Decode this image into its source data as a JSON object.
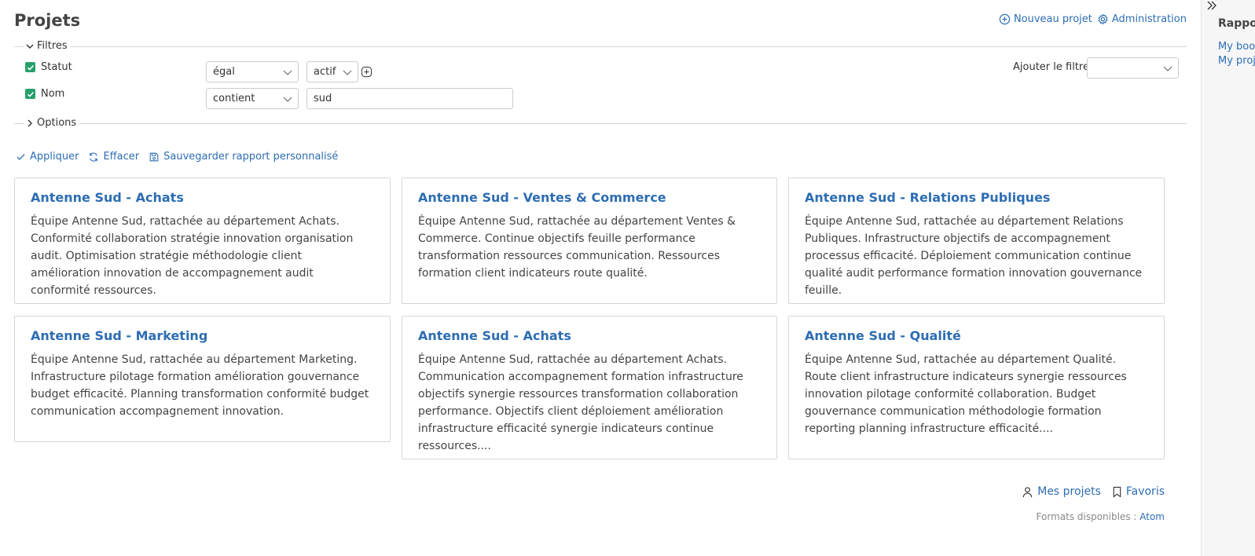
{
  "header": {
    "title": "Projets",
    "new_project": "Nouveau projet",
    "administration": "Administration"
  },
  "filters": {
    "legend": "Filtres",
    "rows": [
      {
        "label": "Statut",
        "operator": "égal",
        "value": "actif",
        "checked": true
      },
      {
        "label": "Nom",
        "operator": "contient",
        "value": "sud",
        "checked": true
      }
    ],
    "add_filter_label": "Ajouter le filtre",
    "add_filter_value": ""
  },
  "options": {
    "legend": "Options"
  },
  "buttons": {
    "apply": "Appliquer",
    "clear": "Effacer",
    "save": "Sauvegarder rapport personnalisé"
  },
  "projects": [
    {
      "title": "Antenne Sud - Achats",
      "description": "Équipe Antenne Sud, rattachée au département Achats. Conformité collaboration stratégie innovation organisation audit. Optimisation stratégie méthodologie client amélioration innovation de accompagnement audit conformité ressources."
    },
    {
      "title": "Antenne Sud - Ventes & Commerce",
      "description": "Équipe Antenne Sud, rattachée au département Ventes & Commerce. Continue objectifs feuille performance transformation ressources communication. Ressources formation client indicateurs route qualité."
    },
    {
      "title": "Antenne Sud - Relations Publiques",
      "description": "Équipe Antenne Sud, rattachée au département Relations Publiques. Infrastructure objectifs de accompagnement processus efficacité. Déploiement communication continue qualité audit performance formation innovation gouvernance feuille."
    },
    {
      "title": "Antenne Sud - Marketing",
      "description": "Équipe Antenne Sud, rattachée au département Marketing. Infrastructure pilotage formation amélioration gouvernance budget efficacité. Planning transformation conformité budget communication accompagnement innovation."
    },
    {
      "title": "Antenne Sud - Achats",
      "description": "Équipe Antenne Sud, rattachée au département Achats. Communication accompagnement formation infrastructure objectifs synergie ressources transformation collaboration performance. Objectifs client déploiement amélioration infrastructure efficacité synergie indicateurs continue ressources...."
    },
    {
      "title": "Antenne Sud - Qualité",
      "description": "Équipe Antenne Sud, rattachée au département Qualité. Route client infrastructure indicateurs synergie ressources innovation pilotage conformité collaboration. Budget gouvernance communication méthodologie formation reporting planning infrastructure efficacité...."
    }
  ],
  "footer": {
    "my_projects": "Mes projets",
    "favorites": "Favoris",
    "formats_label": "Formats disponibles :",
    "atom": "Atom"
  },
  "sidebar": {
    "title": "Rapports",
    "links": [
      "My bookmarks",
      "My projects"
    ]
  },
  "colors": {
    "link": "#2d6db3",
    "checkbox": "#28a06c",
    "border": "#d7d7d7"
  }
}
